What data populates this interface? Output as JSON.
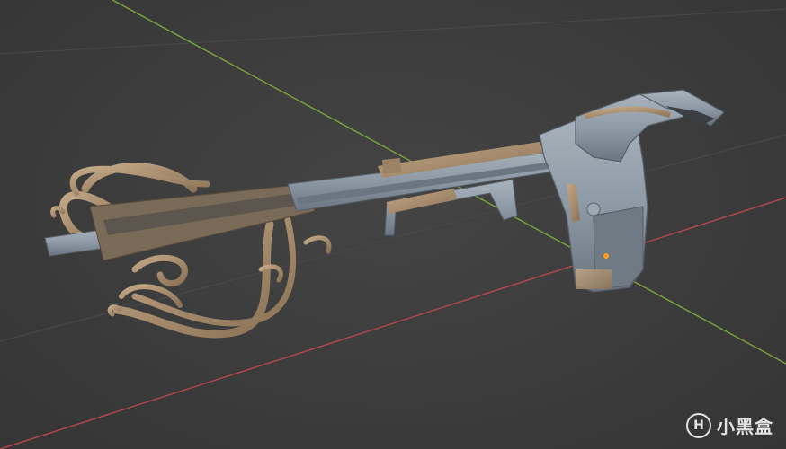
{
  "viewport": {
    "background": "#3d3d3d",
    "x_axis_color": "#b8464f",
    "y_axis_color": "#7aa53c",
    "grid_color": "#4a4a4a"
  },
  "model": {
    "metal_color": "#8e9aa6",
    "brass_color": "#b09674",
    "origin_marker_color": "#ff9a1f"
  },
  "watermark": {
    "logo_text": "H",
    "text": "小黑盒"
  }
}
